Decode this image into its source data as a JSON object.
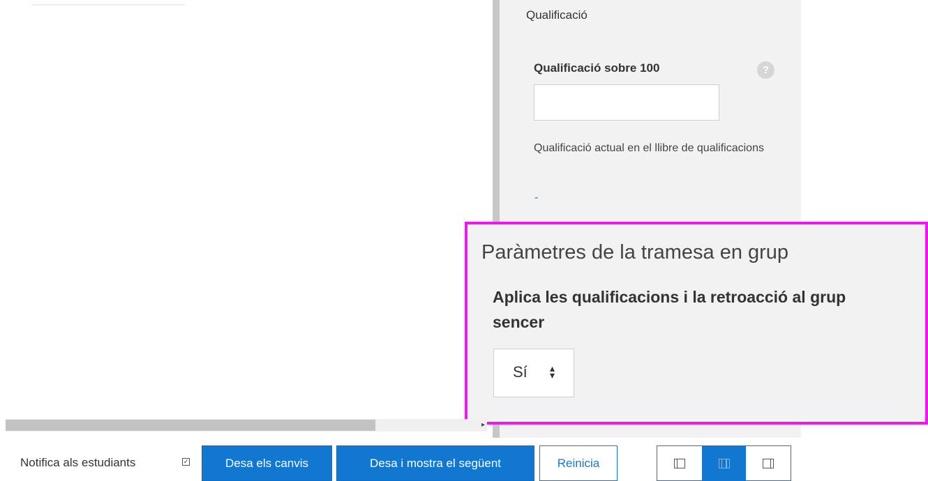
{
  "grade_panel": {
    "heading": "Qualificació",
    "grade_label": "Qualificació sobre 100",
    "grade_value": "",
    "help_icon": "?",
    "current_grade_label": "Qualificació actual en el llibre de qualificacions",
    "current_grade_value": "-"
  },
  "group_settings": {
    "heading": "Paràmetres de la tramesa en grup",
    "apply_label": "Aplica les qualificacions i la retroacció al grup sencer",
    "select_value": "Sí",
    "select_arrows": "▲▼"
  },
  "actions": {
    "notify_label": "Notifica als estudiants",
    "notify_checked": true,
    "save_label": "Desa els canvis",
    "save_next_label": "Desa i mostra el següent",
    "reset_label": "Reinicia"
  },
  "layout_toggle": {
    "icons": [
      "collapse-review-panel-icon",
      "default-layout-icon",
      "collapse-grade-panel-icon"
    ],
    "active_index": 1
  },
  "colors": {
    "primary": "#1177d1",
    "highlight_border": "#f016f0",
    "panel_bg": "#f2f2f2",
    "link": "#2f6fb0"
  }
}
